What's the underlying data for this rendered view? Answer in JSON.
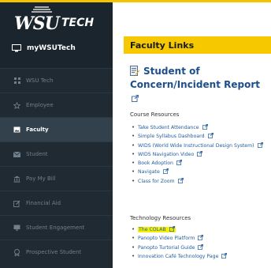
{
  "sidebar": {
    "logo_wsu": "WSU",
    "logo_tech": "TECH",
    "mywsu_label": "myWSUTech",
    "items": [
      {
        "label": "WSU Tech",
        "icon": "grid-icon",
        "active": false
      },
      {
        "label": "Employee",
        "icon": "star-icon",
        "active": false
      },
      {
        "label": "Faculty",
        "icon": "image-icon",
        "active": true
      },
      {
        "label": "Student",
        "icon": "envelope-icon",
        "active": false
      },
      {
        "label": "Pay My Bill",
        "icon": "bank-icon",
        "active": false
      },
      {
        "label": "Financial Aid",
        "icon": "edit-icon",
        "active": false
      },
      {
        "label": "Student Engagement",
        "icon": "monitor-icon",
        "active": false
      },
      {
        "label": "Prospective Student",
        "icon": "badge-icon",
        "active": false
      }
    ]
  },
  "main": {
    "heading": "Faculty Links",
    "report_title_line1": "Student of",
    "report_title_line2": "Concern/Incident Report",
    "course_resources_label": "Course Resources",
    "course_links": [
      "Take Student Attendance",
      "Simple Syllabus Dashboard",
      "WIDS (World Wide Instructional Design System)",
      "WIDS Navigation Video",
      "Book Adoption",
      "Navigate",
      "Class for Zoom"
    ],
    "technology_resources_label": "Technology Resources",
    "technology_links": [
      "The COLAB",
      "Panopto Video Platform",
      "Panopto Turtorial Guide",
      "Innovation Café Technology Page"
    ]
  },
  "colors": {
    "accent": "#f5c800",
    "sidebar_bg": "#1f2a33",
    "link": "#1f5c9e",
    "highlight": "#f6f000"
  }
}
